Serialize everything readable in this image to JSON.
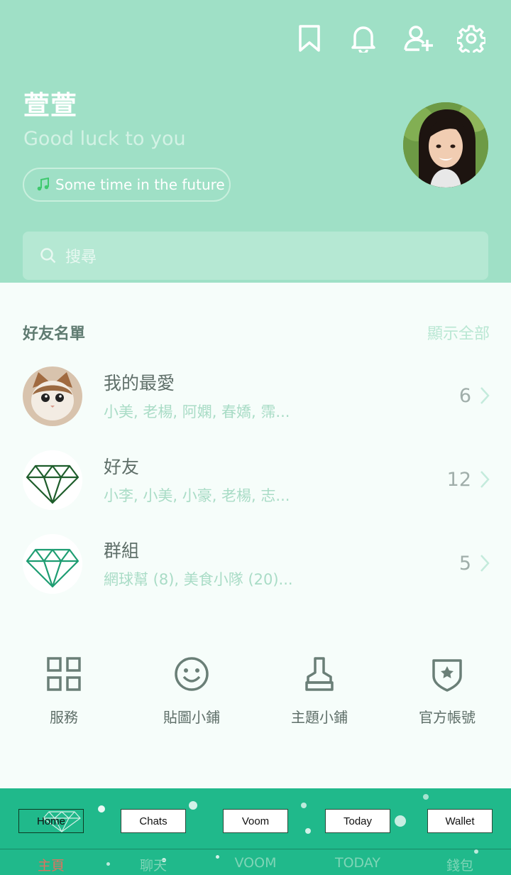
{
  "header": {
    "icons": [
      "bookmark-icon",
      "bell-icon",
      "add-friend-icon",
      "gear-icon"
    ],
    "profile_name": "萱萱",
    "status_message": "Good luck to you",
    "music": "Some time in the future",
    "search_placeholder": "搜尋"
  },
  "friends": {
    "section_title": "好友名單",
    "show_all": "顯示全部",
    "groups": [
      {
        "title": "我的最愛",
        "members": "小美, 老楊, 阿嫻, 春嬌, 霈...",
        "count": "6"
      },
      {
        "title": "好友",
        "members": "小李, 小美, 小豪, 老楊, 志...",
        "count": "12"
      },
      {
        "title": "群組",
        "members": "網球幫 (8), 美食小隊 (20)...",
        "count": "5"
      }
    ]
  },
  "services": [
    {
      "label": "服務",
      "icon": "grid-icon"
    },
    {
      "label": "貼圖小鋪",
      "icon": "smiley-icon"
    },
    {
      "label": "主題小鋪",
      "icon": "brush-icon"
    },
    {
      "label": "官方帳號",
      "icon": "shield-star-icon"
    }
  ],
  "tabbar": {
    "buttons": [
      "Home",
      "Chats",
      "Voom",
      "Today",
      "Wallet"
    ],
    "labels": [
      "主頁",
      "聊天",
      "VOOM",
      "TODAY",
      "錢包"
    ],
    "active_color": "#e0715f",
    "background": "#20b98b"
  }
}
